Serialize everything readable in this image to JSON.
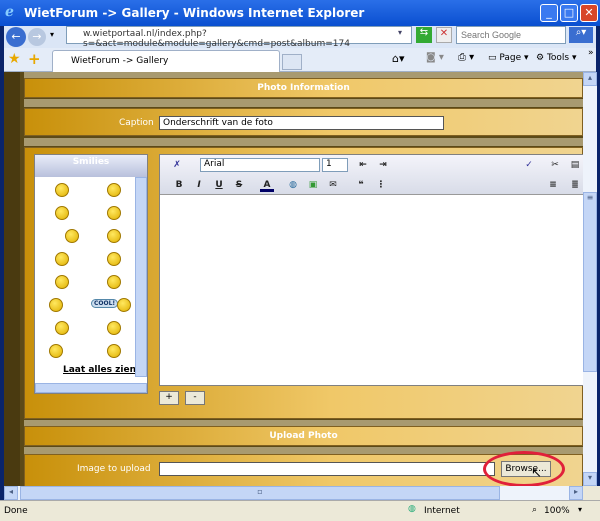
{
  "window": {
    "title": "WietForum -> Gallery - Windows Internet Explorer",
    "minimize": "_",
    "maximize": "□",
    "close": "✕"
  },
  "nav": {
    "address": "w.wietportaal.nl/index.php?s=&act=module&module=gallery&cmd=post&album=174",
    "search_placeholder": "Search Google"
  },
  "tabs": {
    "active": "WietForum -> Gallery",
    "page_menu": "Page",
    "tools_menu": "Tools",
    "chevron": "»"
  },
  "form": {
    "photo_info_header": "Photo Information",
    "caption_label": "Caption",
    "caption_value": "Onderschrift van de foto",
    "smilies_title": "Smilies",
    "show_all_link": "Laat alles zien",
    "cool_label": "COOL!",
    "font_value": "Arial",
    "size_value": "1",
    "bold": "B",
    "italic": "I",
    "underline": "U",
    "strike": "S",
    "font_color": "A",
    "plus_button": "+",
    "minus_button": "-",
    "upload_header": "Upload Photo",
    "image_label": "Image to upload",
    "image_value": "",
    "browse_button": "Browse..."
  },
  "status": {
    "text": "Done",
    "zone": "Internet",
    "zoom": "100%"
  },
  "colors": {
    "highlight_circle": "#e0203a",
    "gold": "#f0c868"
  }
}
